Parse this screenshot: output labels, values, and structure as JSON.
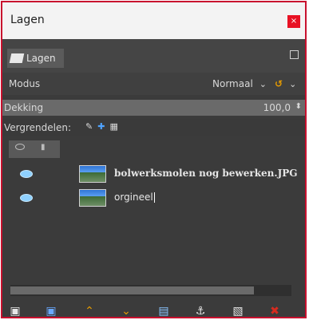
{
  "window": {
    "title": "Lagen",
    "close_label": "×"
  },
  "dock": {
    "tab_label": "Lagen"
  },
  "mode": {
    "label": "Modus",
    "value": "Normaal"
  },
  "opacity": {
    "label": "Dekking",
    "value": "100,0"
  },
  "lock": {
    "label": "Vergrendelen:"
  },
  "layers": [
    {
      "name": "bolwerksmolen nog bewerken.JPG",
      "visible": true
    },
    {
      "name": "orgineel",
      "visible": true
    }
  ],
  "icons": {
    "tab": "layers-icon",
    "dock_menu": "dock-menu-icon",
    "mode_dropdown": "chevron-down-icon",
    "mode_swap": "swap-icon",
    "opacity_spinner": "spinner-icon",
    "lock_pixels": "brush-lock-icon",
    "lock_position": "move-lock-icon",
    "lock_alpha": "alpha-lock-icon",
    "toolbar": [
      "new-layer-icon",
      "new-layer-group-icon",
      "raise-layer-icon",
      "lower-layer-icon",
      "duplicate-layer-icon",
      "anchor-layer-icon",
      "layer-mask-icon",
      "delete-layer-icon"
    ]
  },
  "colors": {
    "window_border": "#c8102e",
    "close_button": "#e81123",
    "raise_lower_icons": "#e69b00",
    "delete_icon": "#d62b1f",
    "visibility_eye": "#8fd1ff"
  }
}
